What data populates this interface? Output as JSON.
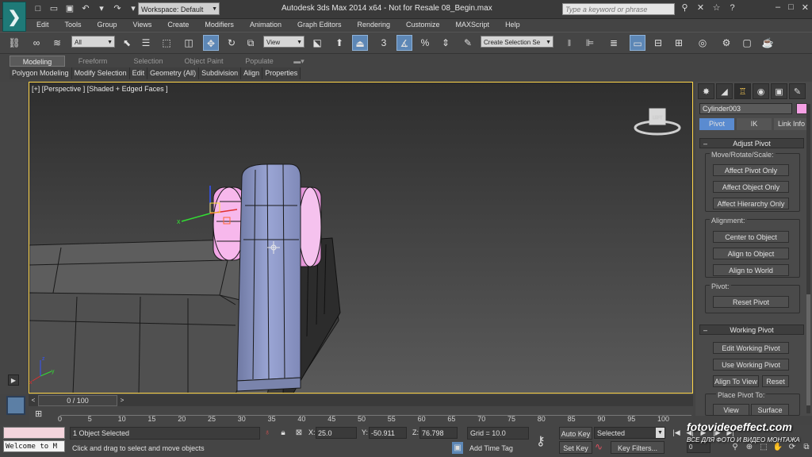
{
  "title_bar": {
    "title": "Autodesk 3ds Max  2014 x64   -  Not for Resale    08_Begin.max",
    "workspace": "Workspace: Default",
    "search_placeholder": "Type a keyword or phrase",
    "quick_access_icons": [
      "new-icon",
      "open-icon",
      "save-icon",
      "undo-icon",
      "redo-icon",
      "project-icon"
    ],
    "help_icons": [
      "binoculars-icon",
      "tools-icon",
      "star-icon",
      "help-icon"
    ],
    "window_controls": [
      "minimize",
      "restore",
      "close"
    ]
  },
  "menu": [
    "Edit",
    "Tools",
    "Group",
    "Views",
    "Create",
    "Modifiers",
    "Animation",
    "Graph Editors",
    "Rendering",
    "Customize",
    "MAXScript",
    "Help"
  ],
  "toolbar": {
    "filter": "All",
    "ref_coord": "View",
    "selection_set": "Create Selection Se",
    "snap_value": "3"
  },
  "ribbon": {
    "tabs": [
      "Modeling",
      "Freeform",
      "Selection",
      "Object Paint",
      "Populate"
    ],
    "active_tab": "Modeling",
    "panels": [
      "Polygon Modeling",
      "Modify Selection",
      "Edit",
      "Geometry (All)",
      "Subdivision",
      "Align",
      "Properties"
    ]
  },
  "viewport": {
    "label": "[+] [Perspective ] [Shaded + Edged Faces ]",
    "viewcube_label": "LEFT",
    "object_color": "#f5a0e4",
    "body_color": "#8f9bc9"
  },
  "command_panel": {
    "tabs": [
      "create-icon",
      "modify-icon",
      "hierarchy-icon",
      "motion-icon",
      "display-icon",
      "utilities-icon"
    ],
    "object_name": "Cylinder003",
    "object_color": "#f5a0e4",
    "hier_tabs": [
      "Pivot",
      "IK",
      "Link Info"
    ],
    "active_hier_tab": "Pivot",
    "adjust_pivot": {
      "title": "Adjust Pivot",
      "move_group": "Move/Rotate/Scale:",
      "move_buttons": [
        "Affect Pivot Only",
        "Affect Object Only",
        "Affect Hierarchy Only"
      ],
      "alignment_group": "Alignment:",
      "alignment_buttons": [
        "Center to Object",
        "Align to Object",
        "Align to World"
      ],
      "pivot_group": "Pivot:",
      "pivot_button": "Reset Pivot"
    },
    "working_pivot": {
      "title": "Working Pivot",
      "buttons": [
        "Edit Working Pivot",
        "Use Working Pivot"
      ],
      "align_to_view": "Align To View",
      "reset": "Reset",
      "place_pivot_label": "Place Pivot To:",
      "view": "View",
      "surface": "Surface"
    }
  },
  "time_slider": {
    "frame_display": "0 / 100",
    "ticks": [
      "0",
      "5",
      "10",
      "15",
      "20",
      "25",
      "30",
      "35",
      "40",
      "45",
      "50",
      "55",
      "60",
      "65",
      "70",
      "75",
      "80",
      "85",
      "90",
      "95",
      "100"
    ]
  },
  "status_bar": {
    "maxscript_output": "Welcome to M",
    "selection_status": "1 Object Selected",
    "prompt": "Click and drag to select and move objects",
    "x_label": "X:",
    "x_value": "25.0",
    "y_label": "Y:",
    "y_value": "-50.911",
    "z_label": "Z:",
    "z_value": "76.798",
    "grid": "Grid = 10.0",
    "add_time_tag": "Add Time Tag",
    "auto_key": "Auto Key",
    "set_key": "Set Key",
    "selected_dropdown": "Selected",
    "key_filters": "Key Filters...",
    "current_frame": "0"
  },
  "watermark": {
    "line1": "fotovideoeffect.com",
    "line2": "ВСЕ ДЛЯ ФОТО И ВИДЕО МОНТАЖА"
  }
}
